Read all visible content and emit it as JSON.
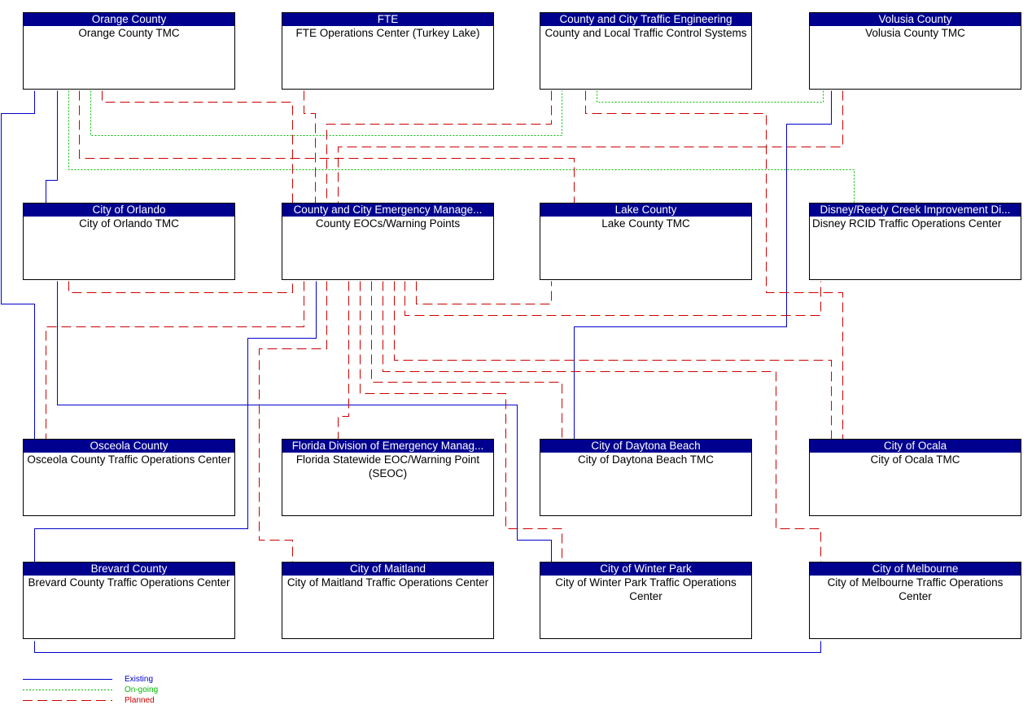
{
  "colors": {
    "existing": "#0000cc",
    "ongoing": "#00bb00",
    "planned": "#cc0000",
    "header": "#00008f"
  },
  "nodes": [
    {
      "id": "orange",
      "header": "Orange County",
      "body": "Orange County TMC"
    },
    {
      "id": "fte",
      "header": "FTE",
      "body": "FTE Operations Center (Turkey Lake)"
    },
    {
      "id": "ccte",
      "header": "County and City Traffic Engineering",
      "body": "County and Local Traffic Control Systems"
    },
    {
      "id": "volusia",
      "header": "Volusia County",
      "body": "Volusia County TMC"
    },
    {
      "id": "orlando",
      "header": "City of Orlando",
      "body": "City of Orlando TMC"
    },
    {
      "id": "eoc",
      "header": "County and City Emergency Manage...",
      "body": "County EOCs/Warning Points"
    },
    {
      "id": "lake",
      "header": "Lake County",
      "body": "Lake County TMC"
    },
    {
      "id": "disney",
      "header": "Disney/Reedy Creek Improvement Di...",
      "body": "Disney RCID Traffic Operations Center"
    },
    {
      "id": "osceola",
      "header": "Osceola County",
      "body": "Osceola County Traffic Operations Center"
    },
    {
      "id": "seoc",
      "header": "Florida Division of Emergency Manag...",
      "body": "Florida Statewide EOC/Warning Point (SEOC)"
    },
    {
      "id": "daytona",
      "header": "City of Daytona Beach",
      "body": "City of Daytona Beach TMC"
    },
    {
      "id": "ocala",
      "header": "City of Ocala",
      "body": "City of Ocala TMC"
    },
    {
      "id": "brevard",
      "header": "Brevard County",
      "body": "Brevard County Traffic Operations Center"
    },
    {
      "id": "maitland",
      "header": "City of Maitland",
      "body": "City of Maitland Traffic Operations Center"
    },
    {
      "id": "winterpark",
      "header": "City of Winter Park",
      "body": "City of Winter Park Traffic Operations Center"
    },
    {
      "id": "melbourne",
      "header": "City of Melbourne",
      "body": "City of Melbourne Traffic Operations Center"
    }
  ],
  "links": [
    {
      "from": "orange",
      "to": "osceola",
      "status": "existing"
    },
    {
      "from": "orange",
      "to": "orlando",
      "status": "existing"
    },
    {
      "from": "orlando",
      "to": "winterpark",
      "status": "existing"
    },
    {
      "from": "eoc",
      "to": "brevard",
      "status": "existing"
    },
    {
      "from": "volusia",
      "to": "daytona",
      "status": "existing"
    },
    {
      "from": "brevard",
      "to": "melbourne",
      "status": "existing"
    },
    {
      "from": "orange",
      "to": "ccte",
      "status": "ongoing"
    },
    {
      "from": "orange",
      "to": "disney",
      "status": "ongoing"
    },
    {
      "from": "ccte",
      "to": "volusia",
      "status": "ongoing"
    },
    {
      "from": "orange",
      "to": "eoc",
      "status": "planned"
    },
    {
      "from": "fte",
      "to": "eoc",
      "status": "planned"
    },
    {
      "from": "ccte",
      "to": "eoc",
      "status": "planned"
    },
    {
      "from": "volusia",
      "to": "eoc",
      "status": "planned"
    },
    {
      "from": "orange",
      "to": "lake",
      "status": "planned"
    },
    {
      "from": "ccte",
      "to": "ocala",
      "status": "planned"
    },
    {
      "from": "orlando",
      "to": "eoc",
      "status": "planned"
    },
    {
      "from": "eoc",
      "to": "osceola",
      "status": "planned"
    },
    {
      "from": "eoc",
      "to": "maitland",
      "status": "planned"
    },
    {
      "from": "eoc",
      "to": "seoc",
      "status": "planned"
    },
    {
      "from": "eoc",
      "to": "winterpark",
      "status": "planned"
    },
    {
      "from": "eoc",
      "to": "daytona",
      "status": "planned"
    },
    {
      "from": "eoc",
      "to": "melbourne",
      "status": "planned"
    },
    {
      "from": "eoc",
      "to": "ocala",
      "status": "planned"
    },
    {
      "from": "eoc",
      "to": "disney",
      "status": "planned"
    },
    {
      "from": "eoc",
      "to": "lake",
      "status": "planned"
    }
  ],
  "legend": [
    {
      "status": "existing",
      "label": "Existing"
    },
    {
      "status": "ongoing",
      "label": "On-going"
    },
    {
      "status": "planned",
      "label": "Planned"
    }
  ]
}
